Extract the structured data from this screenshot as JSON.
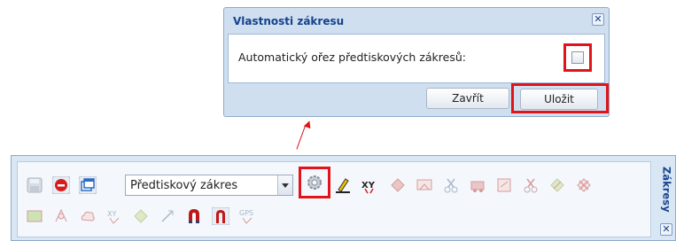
{
  "dialog": {
    "title": "Vlastnosti zákresu",
    "close_glyph": "✕",
    "auto_crop_label": "Automatický ořez předtiskových zákresů:",
    "auto_crop_checked": false,
    "close_button_label": "Zavřít",
    "save_button_label": "Uložit"
  },
  "panel": {
    "side_title": "Zákresy",
    "close_glyph": "✕",
    "layer_select": {
      "selected": "Předtiskový zákres"
    },
    "row1_icons": [
      "save-icon",
      "delete-icon",
      "windows-icon",
      "settings-gear-icon",
      "edit-pencil-icon",
      "xy-snap-icon",
      "draw-polygon-icon",
      "select-area-icon",
      "scissors-icon",
      "move-icon",
      "rotate-area-icon",
      "split-icon",
      "merge-icon",
      "remove-icon"
    ],
    "row2_icons": [
      "parcel-icon",
      "vertex-icon",
      "cloud-icon",
      "xy-coordinates-icon",
      "shape-icon",
      "line-arrow-icon",
      "magnet-icon",
      "gps-icon"
    ],
    "xy_text": "XY",
    "gps_text": "GPS"
  },
  "colors": {
    "highlight": "#e0141a",
    "title_blue": "#15428b",
    "panel_bg": "#d9e6f4"
  }
}
